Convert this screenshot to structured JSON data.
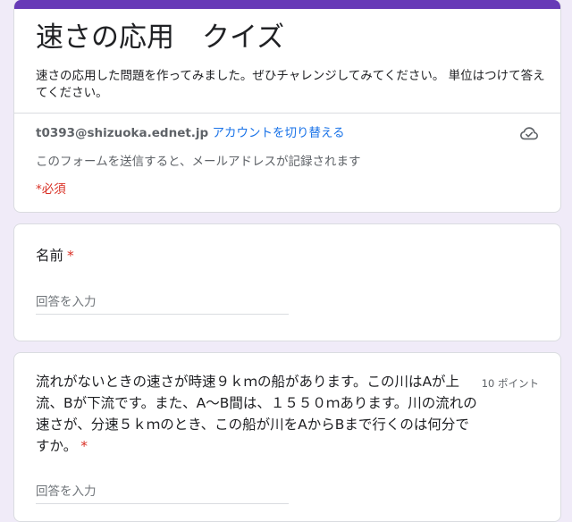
{
  "form": {
    "title": "速さの応用　クイズ",
    "description": "速さの応用した問題を作ってみました。ぜひチャレンジしてみてください。 単位はつけて答えてください。",
    "accent_color": "#673ab7",
    "background_color": "#f0ebf8"
  },
  "account": {
    "email": "t0393@shizuoka.ednet.jp",
    "switch_label": "アカウントを切り替える",
    "cloud_icon": "cloud-saved-icon",
    "email_notice": "このフォームを送信すると、メールアドレスが記録されます",
    "required_notice": "*必須",
    "required_color": "#d93025",
    "link_color": "#1a73e8"
  },
  "questions": [
    {
      "title": "名前",
      "required_mark": "*",
      "placeholder": "回答を入力",
      "value": ""
    },
    {
      "title": "流れがないときの速さが時速９ｋｍの船があります。この川はAが上流、Bが下流です。また、A～B間は、１５５０ｍあります。川の流れの速さが、分速５ｋｍのとき、この船が川をAからBまで行くのは何分ですか。",
      "required_mark": "*",
      "points": "10 ポイント",
      "placeholder": "回答を入力",
      "value": ""
    }
  ]
}
